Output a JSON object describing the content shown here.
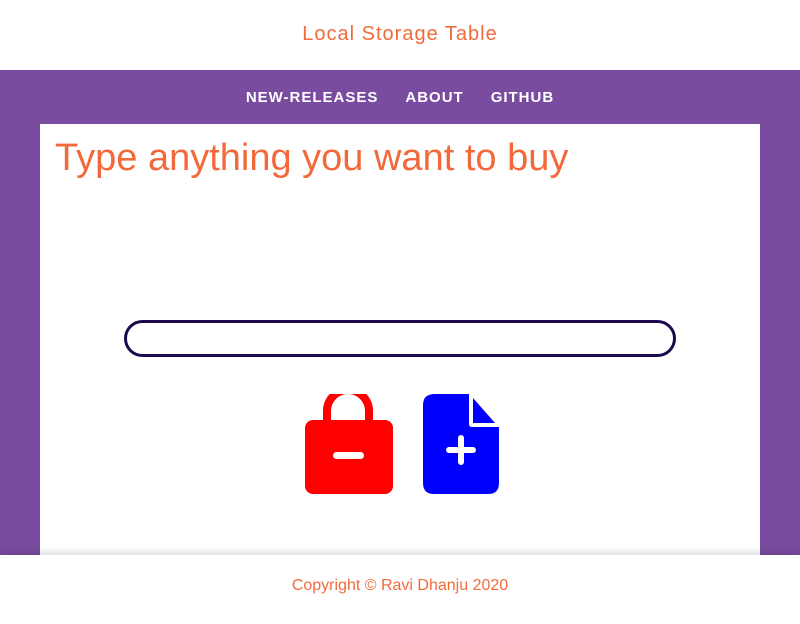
{
  "header": {
    "title": "Local Storage Table"
  },
  "nav": {
    "items": [
      {
        "label": "NEW-RELEASES"
      },
      {
        "label": "ABOUT"
      },
      {
        "label": "GITHUB"
      }
    ]
  },
  "main": {
    "heading": "Type anything you want to buy",
    "input": {
      "value": "",
      "placeholder": ""
    },
    "buttons": {
      "remove_icon": "shopping-bag-minus-icon",
      "add_icon": "file-plus-icon"
    }
  },
  "footer": {
    "copyright": "Copyright © Ravi Dhanju 2020"
  },
  "colors": {
    "accent": "#f26a3c",
    "band": "#7a4ca0",
    "input_border": "#1c0a4e",
    "remove": "#ff0000",
    "add": "#0000ff"
  }
}
